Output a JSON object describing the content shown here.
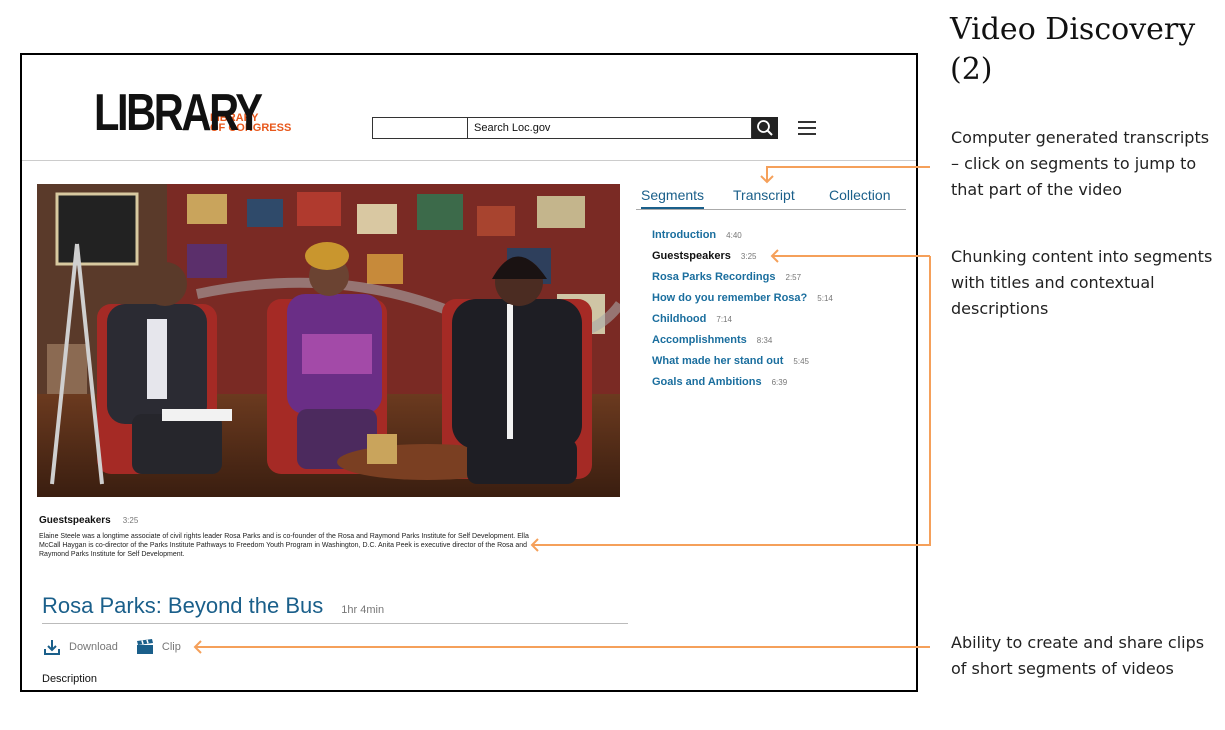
{
  "annotations": {
    "title": "Video Discovery (2)",
    "note1": "Computer generated transcripts – click on segments to jump to that part of the video",
    "note2": "Chunking content into segments with titles and contextual descriptions",
    "note3": "Ability to create and share clips of short segments of videos"
  },
  "colors": {
    "link": "#1a5f8a",
    "accent": "#e8581c",
    "annotation_arrow": "#f5a05a"
  },
  "header": {
    "logo_big": "LIBRARY",
    "logo_small_line1": "LIBRARY",
    "logo_small_line2": "OF CONGRESS",
    "search_placeholder": "Search Loc.gov",
    "search_icon": "search-icon",
    "menu_icon": "hamburger-menu-icon"
  },
  "tabs": [
    {
      "label": "Segments",
      "active": true
    },
    {
      "label": "Transcript",
      "active": false
    },
    {
      "label": "Collection",
      "active": false
    }
  ],
  "segments": [
    {
      "title": "Introduction",
      "time": "4:40"
    },
    {
      "title": "Guestspeakers",
      "time": "3:25",
      "current": true
    },
    {
      "title": "Rosa Parks Recordings",
      "time": "2:57"
    },
    {
      "title": "How do you remember Rosa?",
      "time": "5:14"
    },
    {
      "title": "Childhood",
      "time": "7:14"
    },
    {
      "title": "Accomplishments",
      "time": "8:34"
    },
    {
      "title": "What made her stand out",
      "time": "5:45"
    },
    {
      "title": "Goals and Ambitions",
      "time": "6:39"
    }
  ],
  "current_segment": {
    "title": "Guestspeakers",
    "time": "3:25",
    "description": "Elaine Steele was a longtime associate of civil rights leader Rosa Parks and is co-founder of the Rosa and Raymond Parks Institute for Self Development. Ella McCall Haygan is co-director of the Parks Institute Pathways to Freedom Youth Program in Washington, D.C. Anita Peek is executive director of the Rosa and Raymond Parks Institute for Self Development."
  },
  "video": {
    "title": "Rosa Parks: Beyond the Bus",
    "duration": "1hr 4min"
  },
  "actions": {
    "download": "Download",
    "clip": "Clip"
  },
  "description_label": "Description"
}
